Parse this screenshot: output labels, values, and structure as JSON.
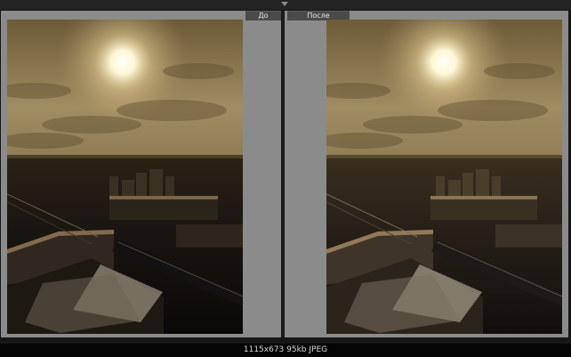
{
  "compare": {
    "before_label": "До",
    "after_label": "После"
  },
  "image": {
    "status": "1115x673  95kb  JPEG",
    "subject": "aerial-city-under-sun"
  }
}
